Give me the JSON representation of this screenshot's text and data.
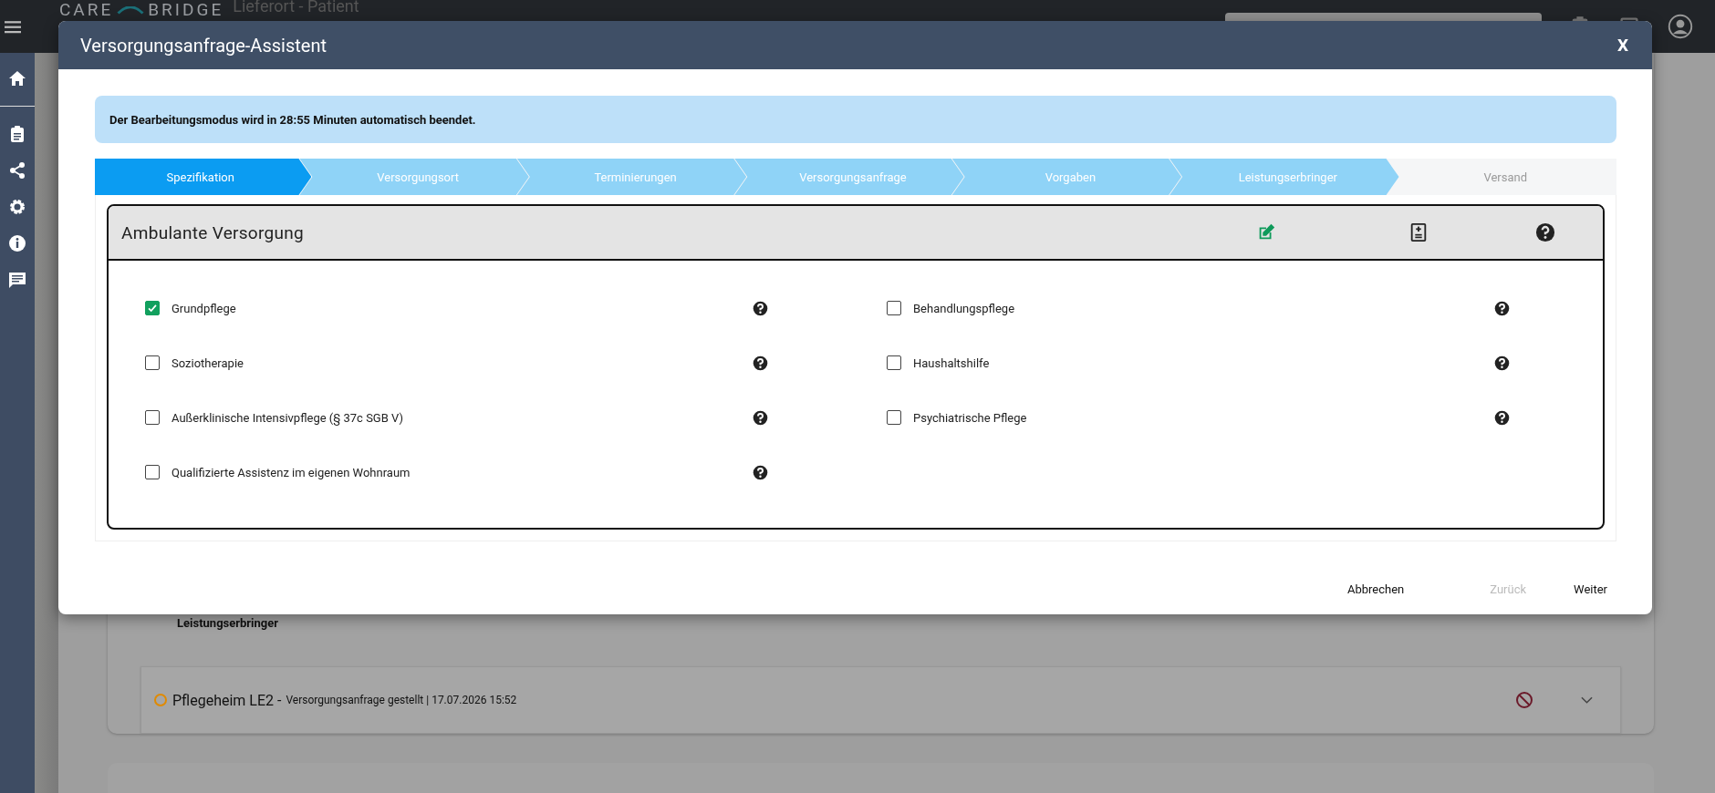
{
  "app_bar": {
    "logo_left": "CARE",
    "logo_right": "BRIDGE",
    "page_heading": "Lieferort - Patient"
  },
  "background": {
    "section_label": "Leistungserbringer",
    "providers": [
      {
        "name": "Pflegeheim LE2 -",
        "status": "Versorgungsanfrage gestellt | 17.07.2026 15:52",
        "color": "#e08a00"
      }
    ]
  },
  "dialog": {
    "title": "Versorgungsanfrage-Assistent",
    "close": "X",
    "notice": "Der Bearbeitungsmodus wird in 28:55 Minuten automatisch beendet.",
    "steps": [
      {
        "label": "Spezifikation",
        "selected": true,
        "disabled": false
      },
      {
        "label": "Versorgungsort",
        "selected": false,
        "disabled": false
      },
      {
        "label": "Terminierungen",
        "selected": false,
        "disabled": false
      },
      {
        "label": "Versorgungsanfrage",
        "selected": false,
        "disabled": false
      },
      {
        "label": "Vorgaben",
        "selected": false,
        "disabled": false
      },
      {
        "label": "Leistungserbringer",
        "selected": false,
        "disabled": false
      },
      {
        "label": "Versand",
        "selected": false,
        "disabled": true
      }
    ],
    "section_title": "Ambulante Versorgung",
    "left_options": [
      {
        "label": "Grundpflege",
        "checked": true
      },
      {
        "label": "Soziotherapie",
        "checked": false
      },
      {
        "label": "Außerklinische Intensivpflege (§ 37c SGB V)",
        "checked": false
      },
      {
        "label": "Qualifizierte Assistenz im eigenen Wohnraum",
        "checked": false
      }
    ],
    "right_options": [
      {
        "label": "Behandlungspflege",
        "checked": false
      },
      {
        "label": "Haushaltshilfe",
        "checked": false
      },
      {
        "label": "Psychiatrische Pflege",
        "checked": false
      }
    ],
    "buttons": [
      {
        "label": "Abbrechen",
        "disabled": false
      },
      {
        "label": "Zurück",
        "disabled": true
      },
      {
        "label": "Weiter",
        "disabled": false
      }
    ]
  }
}
